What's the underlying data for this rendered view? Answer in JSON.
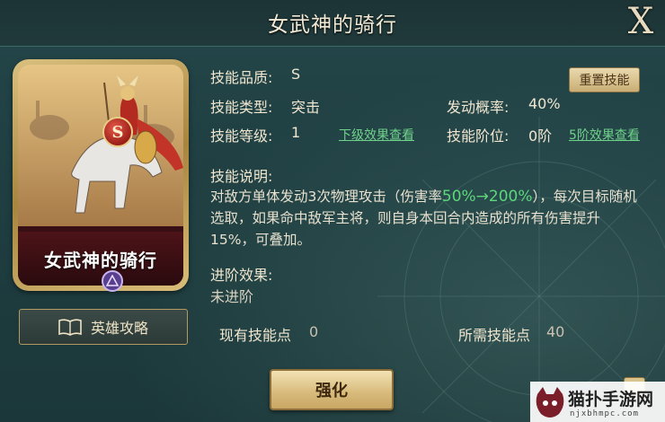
{
  "header": {
    "title": "女武神的骑行",
    "close_label": "X"
  },
  "card": {
    "name": "女武神的骑行",
    "rank": "S"
  },
  "guide_button": {
    "label": "英雄攻略"
  },
  "skill": {
    "quality_label": "技能品质:",
    "quality_value": "S",
    "type_label": "技能类型:",
    "type_value": "突击",
    "chance_label": "发动概率:",
    "chance_value": "40%",
    "level_label": "技能等级:",
    "level_value": "1",
    "level_link": "下级效果查看",
    "stage_label": "技能阶位:",
    "stage_value": "0阶",
    "stage_link": "5阶效果查看",
    "reset_label": "重置技能",
    "desc_label": "技能说明:",
    "desc_part1": "对敌方单体发动3次物理攻击（伤害率",
    "desc_highlight": "50%→200%",
    "desc_part2": "），每次目标随机选取，如果命中敌军主将，则自身本回合内造成的所有伤害提升15%，可叠加。",
    "advance_label": "进阶效果:",
    "advance_value": "未进阶"
  },
  "points": {
    "current_label": "现有技能点",
    "current_value": "0",
    "required_label": "所需技能点",
    "required_value": "40"
  },
  "strengthen_button": {
    "label": "强化"
  },
  "watermark": {
    "text": "猫扑手游网",
    "sub": "njxbhmpc.com"
  }
}
